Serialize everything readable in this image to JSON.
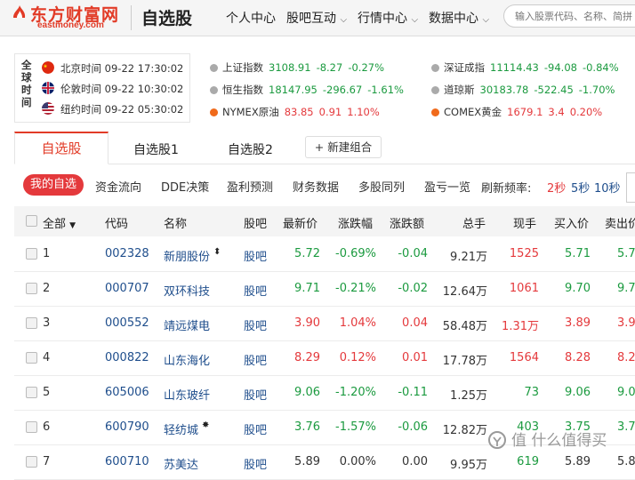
{
  "header": {
    "logo_text": "东方财富网",
    "logo_sub": "eastmoney.com",
    "page_title": "自选股",
    "nav": [
      {
        "label": "个人中心",
        "has_menu": false
      },
      {
        "label": "股吧互动",
        "has_menu": true
      },
      {
        "label": "行情中心",
        "has_menu": true
      },
      {
        "label": "数据中心",
        "has_menu": true
      }
    ],
    "search_placeholder": "输入股票代码、名称、简拼"
  },
  "global_time": {
    "label": "全球时间",
    "clocks": [
      {
        "city": "北京时间 09-22 17:30:02",
        "flag": "china-flag-icon"
      },
      {
        "city": "伦敦时间 09-22 10:30:02",
        "flag": "uk-flag-icon"
      },
      {
        "city": "纽约时间 09-22 05:30:02",
        "flag": "us-flag-icon"
      }
    ]
  },
  "indices": [
    {
      "name": "上证指数",
      "price": "3108.91",
      "change": "-8.27",
      "pct": "-0.27%",
      "dir": "down"
    },
    {
      "name": "深证成指",
      "price": "11114.43",
      "change": "-94.08",
      "pct": "-0.84%",
      "dir": "down"
    },
    {
      "name": "恒生指数",
      "price": "18147.95",
      "change": "-296.67",
      "pct": "-1.61%",
      "dir": "down"
    },
    {
      "name": "道琼斯",
      "price": "30183.78",
      "change": "-522.45",
      "pct": "-1.70%",
      "dir": "down"
    },
    {
      "name": "NYMEX原油",
      "price": "83.85",
      "change": "0.91",
      "pct": "1.10%",
      "dir": "up"
    },
    {
      "name": "COMEX黄金",
      "price": "1679.1",
      "change": "3.4",
      "pct": "0.20%",
      "dir": "up"
    }
  ],
  "tabs": {
    "active": "自选股",
    "others": [
      "自选股1",
      "自选股2"
    ],
    "new_group": "+ 新建组合"
  },
  "subnav": {
    "active": "我的自选",
    "items": [
      "资金流向",
      "DDE决策",
      "盈利预测",
      "财务数据",
      "多股同列",
      "盈亏一览"
    ],
    "refresh_label": "刷新频率:",
    "refresh_options": [
      "2秒",
      "5秒",
      "10秒"
    ],
    "refresh_selected": "2秒"
  },
  "table": {
    "headers": [
      "全部",
      "代码",
      "名称",
      "股吧",
      "最新价",
      "涨跌幅",
      "涨跌额",
      "总手",
      "现手",
      "买入价",
      "卖出价"
    ],
    "rows": [
      {
        "idx": "1",
        "code": "002328",
        "name": "新朋股份",
        "mark": "⬍",
        "bar": "股吧",
        "price": "5.72",
        "pct": "-0.69%",
        "chg": "-0.04",
        "vol": "9.21万",
        "cur": "1525",
        "cur_dir": "up",
        "bid": "5.71",
        "ask": "5.7",
        "dir": "down"
      },
      {
        "idx": "2",
        "code": "000707",
        "name": "双环科技",
        "mark": "",
        "bar": "股吧",
        "price": "9.71",
        "pct": "-0.21%",
        "chg": "-0.02",
        "vol": "12.64万",
        "cur": "1061",
        "cur_dir": "up",
        "bid": "9.70",
        "ask": "9.7",
        "dir": "down"
      },
      {
        "idx": "3",
        "code": "000552",
        "name": "靖远煤电",
        "mark": "",
        "bar": "股吧",
        "price": "3.90",
        "pct": "1.04%",
        "chg": "0.04",
        "vol": "58.48万",
        "cur": "1.31万",
        "cur_dir": "up",
        "bid": "3.89",
        "ask": "3.9",
        "dir": "up"
      },
      {
        "idx": "4",
        "code": "000822",
        "name": "山东海化",
        "mark": "",
        "bar": "股吧",
        "price": "8.29",
        "pct": "0.12%",
        "chg": "0.01",
        "vol": "17.78万",
        "cur": "1564",
        "cur_dir": "up",
        "bid": "8.28",
        "ask": "8.2",
        "dir": "up"
      },
      {
        "idx": "5",
        "code": "605006",
        "name": "山东玻纤",
        "mark": "",
        "bar": "股吧",
        "price": "9.06",
        "pct": "-1.20%",
        "chg": "-0.11",
        "vol": "1.25万",
        "cur": "73",
        "cur_dir": "down",
        "bid": "9.06",
        "ask": "9.0",
        "dir": "down"
      },
      {
        "idx": "6",
        "code": "600790",
        "name": "轻纺城",
        "mark": "✸",
        "bar": "股吧",
        "price": "3.76",
        "pct": "-1.57%",
        "chg": "-0.06",
        "vol": "12.82万",
        "cur": "403",
        "cur_dir": "down",
        "bid": "3.75",
        "ask": "3.7",
        "dir": "down"
      },
      {
        "idx": "7",
        "code": "600710",
        "name": "苏美达",
        "mark": "",
        "bar": "股吧",
        "price": "5.89",
        "pct": "0.00%",
        "chg": "0.00",
        "vol": "9.95万",
        "cur": "619",
        "cur_dir": "down",
        "bid": "5.89",
        "ask": "5.8",
        "dir": "flat"
      }
    ]
  },
  "watermark": "值 什么值得买",
  "colors": {
    "brand": "#e23b27",
    "up": "#e4393c",
    "down": "#1b9a3f",
    "link": "#1f4e8c"
  }
}
